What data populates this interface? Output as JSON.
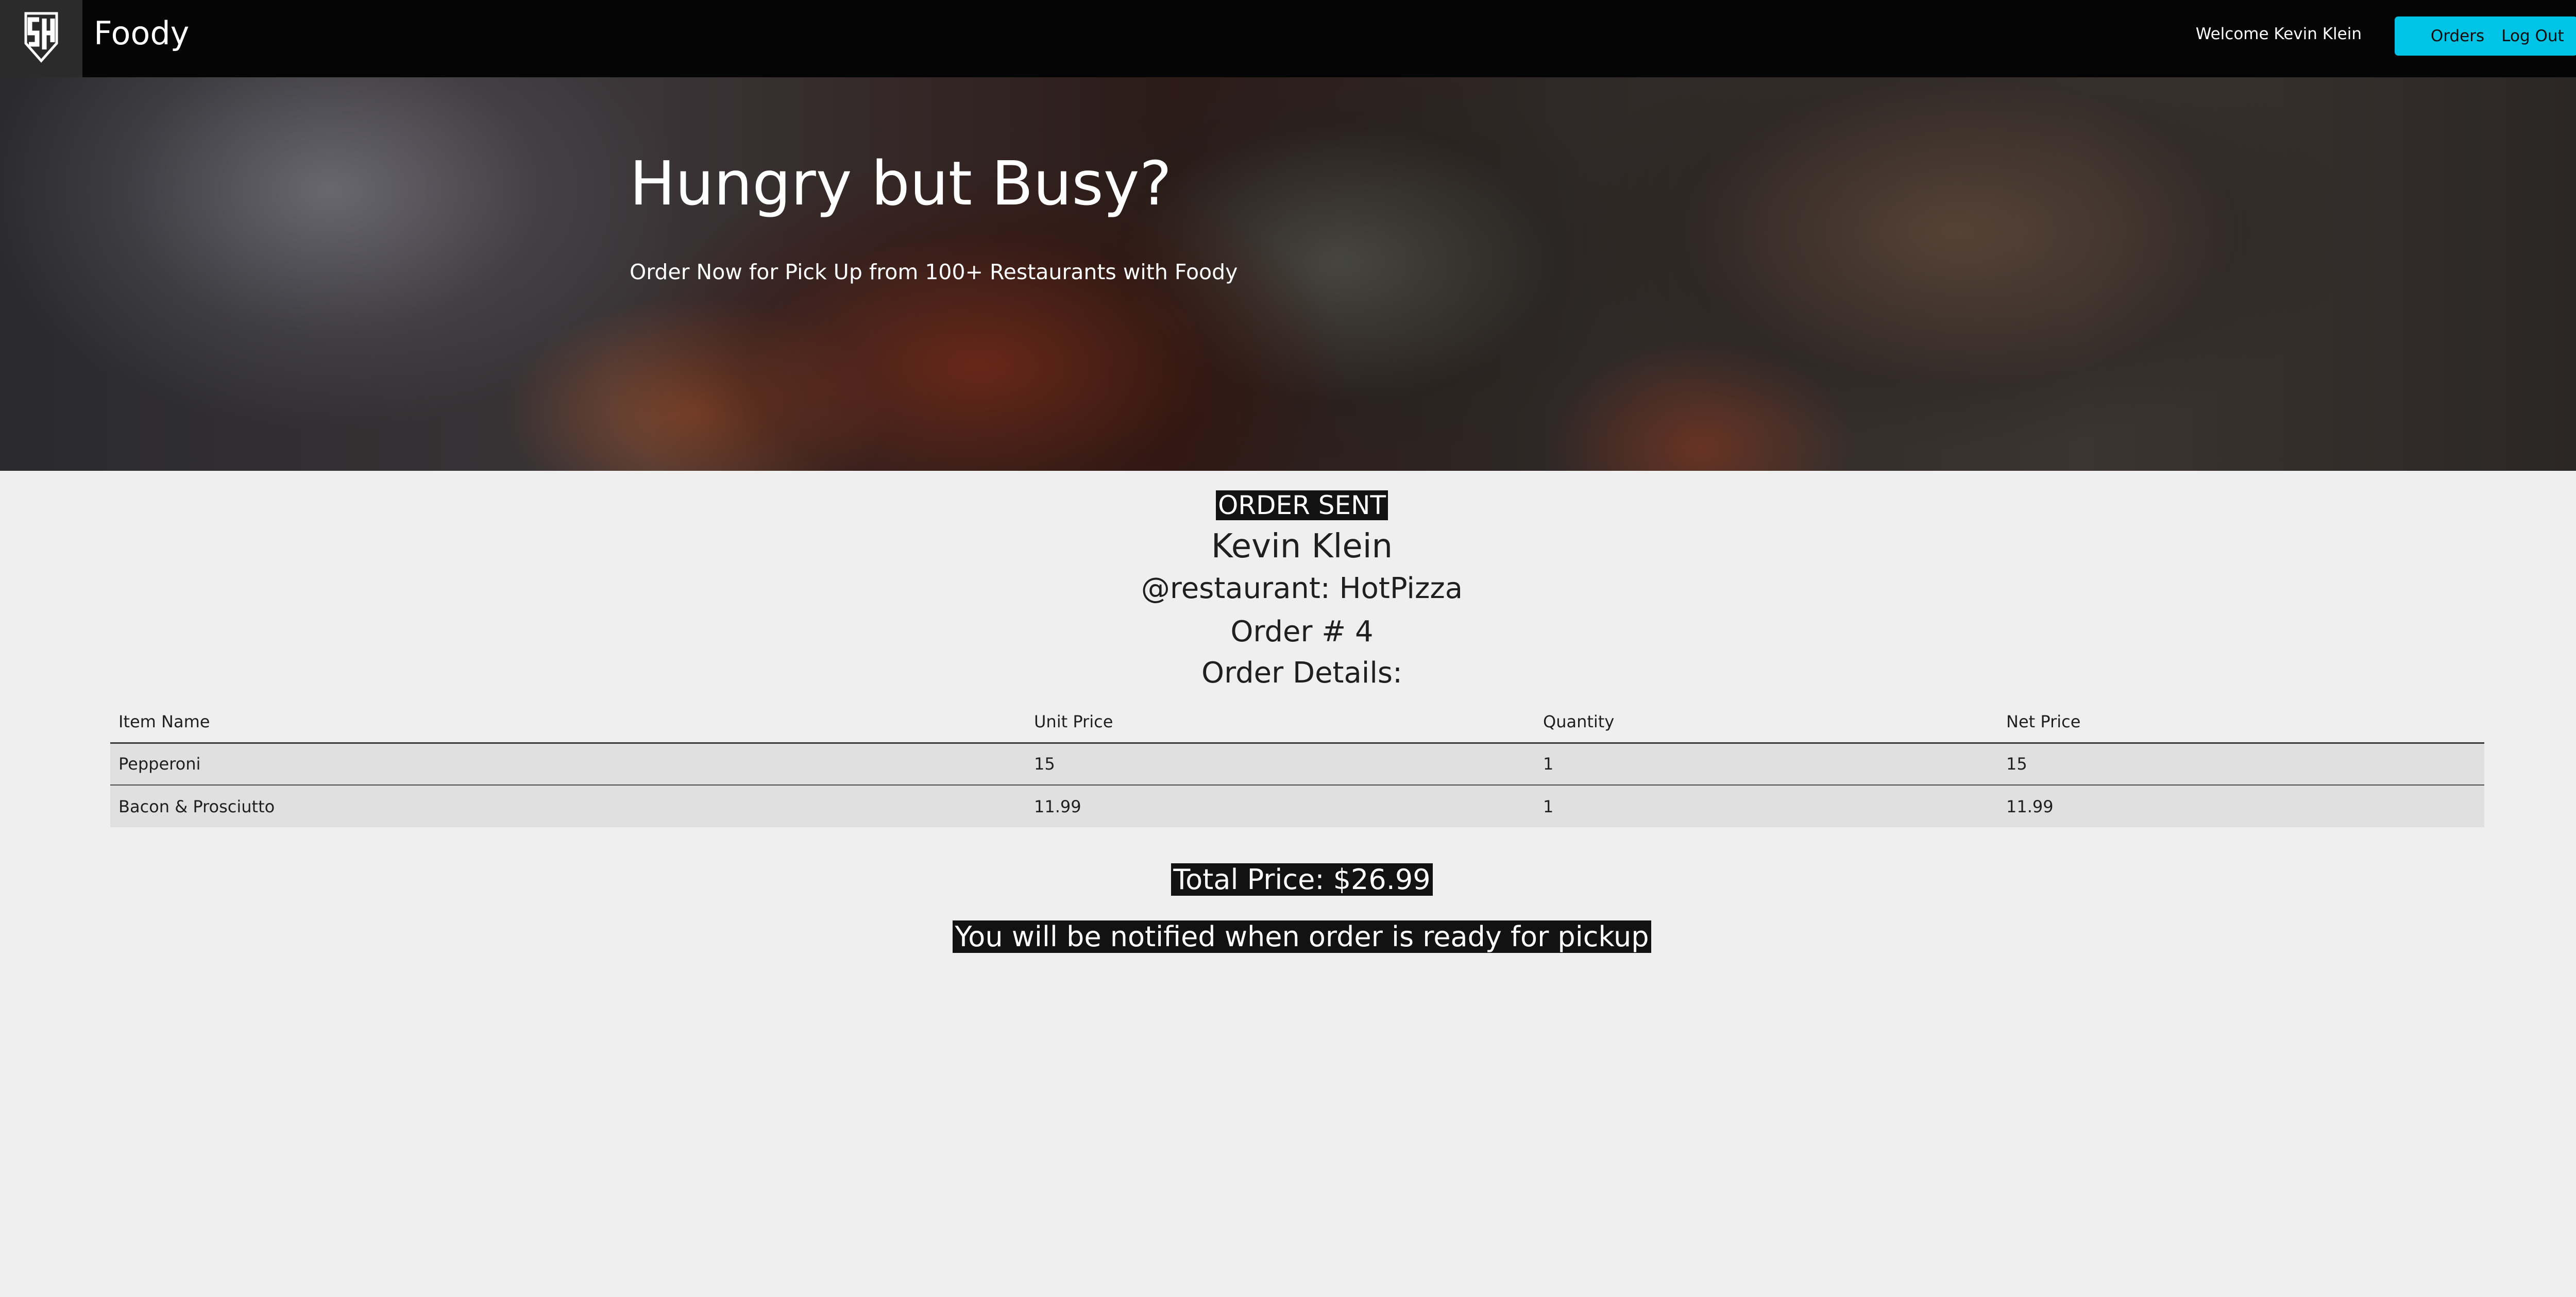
{
  "header": {
    "brand": "Foody",
    "welcome": "Welcome Kevin Klein",
    "orders_label": "Orders",
    "logout_label": "Log Out",
    "logo_icon": "sh-shield-logo-icon",
    "accent_color": "#00c4e6"
  },
  "hero": {
    "title": "Hungry but Busy?",
    "subtitle": "Order Now for Pick Up from 100+ Restaurants with Foody"
  },
  "order": {
    "status": "ORDER SENT",
    "customer": "Kevin Klein",
    "restaurant": "@restaurant: HotPizza",
    "order_number": "Order # 4",
    "details_heading": "Order Details:",
    "columns": [
      "Item Name",
      "Unit Price",
      "Quantity",
      "Net Price"
    ],
    "items": [
      [
        "Pepperoni",
        "15",
        "1",
        "15"
      ],
      [
        "Bacon & Prosciutto",
        "11.99",
        "1",
        "11.99"
      ]
    ],
    "total": "Total Price: $26.99",
    "notice": "You will be notified when order is ready for pickup"
  }
}
